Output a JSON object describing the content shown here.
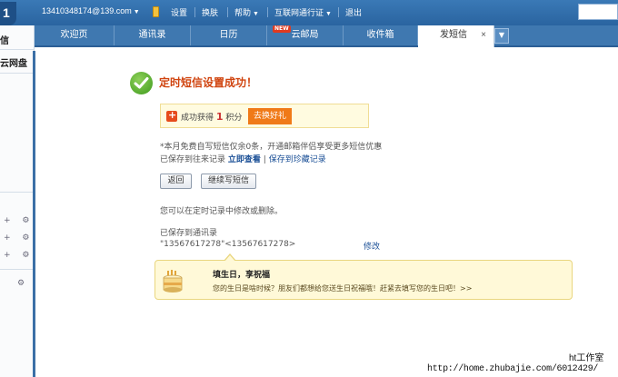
{
  "header": {
    "logo_char": "1",
    "account": "13410348174@139.com",
    "menu": [
      "设置",
      "换肤",
      "帮助",
      "互联网通行证",
      "退出"
    ]
  },
  "tabs": [
    {
      "label": "欢迎页"
    },
    {
      "label": "通讯录"
    },
    {
      "label": "日历",
      "badge": "NEW"
    },
    {
      "label": "云邮局"
    },
    {
      "label": "收件箱"
    },
    {
      "label": "发短信",
      "active": true,
      "close": "×"
    }
  ],
  "tab_more": "▼",
  "sidebar": {
    "items": [
      "信",
      "云网盘"
    ],
    "controls": [
      "+ ⚙",
      "+ ⚙",
      "+ ⚙",
      "⚙"
    ]
  },
  "success": {
    "title": "定时短信设置成功！"
  },
  "points": {
    "prefix": "成功获得",
    "amount": "1",
    "suffix": "积分",
    "button": "去换好礼"
  },
  "notice": {
    "line1": "*本月免费自写短信仅余0条，开通邮箱伴侣享受更多短信优惠",
    "line2_prefix": "已保存到往来记录",
    "view_link": "立即查看",
    "divider": "|",
    "save_link": "保存到珍藏记录"
  },
  "buttons": {
    "back": "返回",
    "continue": "继续写短信"
  },
  "schedule_note": "您可以在定时记录中修改或删除。",
  "contacts": {
    "heading": "已保存到通讯录",
    "entry": "\"13567617278\"<13567617278>",
    "edit": "修改"
  },
  "birthday": {
    "title": "填生日，享祝福",
    "message": "您的生日是啥时候？朋友们都想给您送生日祝福哦！赶紧去填写您的生日吧！>>"
  },
  "watermark": {
    "line1": "ht工作室",
    "line2": "http://home.zhubajie.com/6012429/"
  }
}
